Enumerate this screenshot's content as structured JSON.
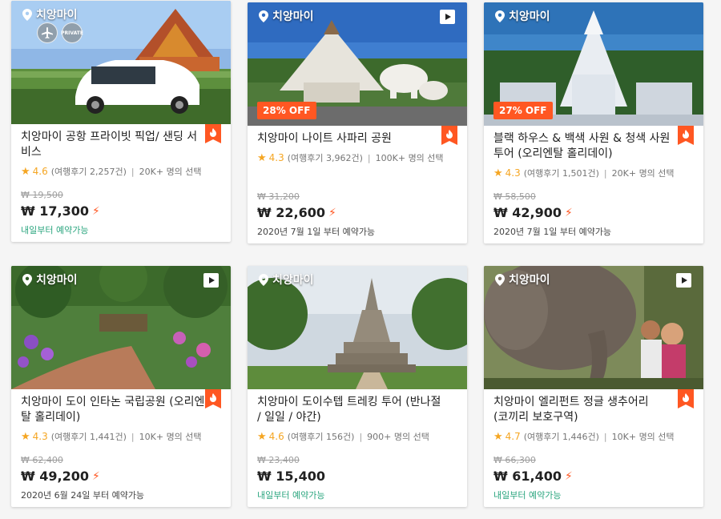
{
  "cards": [
    {
      "location": "치앙마이",
      "title": "치앙마이 공항 프라이빗 픽업/ 샌딩 서비스",
      "rating": "4.6",
      "reviews": "(여행후기 2,257건)",
      "chosen": "20K+ 명의 선택",
      "old_price": "₩ 19,500",
      "price": "₩ 17,300",
      "availability": "내일부터 예약가능",
      "feature_badge": "PRIVATE"
    },
    {
      "location": "치앙마이",
      "title": "치앙마이 나이트 사파리 공원",
      "rating": "4.3",
      "reviews": "(여행후기 3,962건)",
      "chosen": "100K+ 명의 선택",
      "old_price": "₩ 31,200",
      "price": "₩ 22,600",
      "availability": "2020년 7월 1일 부터 예약가능",
      "discount": "28% OFF"
    },
    {
      "location": "치앙마이",
      "title": "블랙 하우스 & 백색 사원 & 청색 사원 투어 (오리엔탈 홀리데이)",
      "rating": "4.3",
      "reviews": "(여행후기 1,501건)",
      "chosen": "20K+ 명의 선택",
      "old_price": "₩ 58,500",
      "price": "₩ 42,900",
      "availability": "2020년 7월 1일 부터 예약가능",
      "discount": "27% OFF"
    },
    {
      "location": "치앙마이",
      "title": "치앙마이 도이 인타논 국립공원 (오리엔탈 홀리데이)",
      "rating": "4.3",
      "reviews": "(여행후기 1,441건)",
      "chosen": "10K+ 명의 선택",
      "old_price": "₩ 62,400",
      "price": "₩ 49,200",
      "availability": "2020년 6월 24일 부터 예약가능"
    },
    {
      "location": "치앙마이",
      "title": "치앙마이 도이수텝 트레킹 투어 (반나절 / 일일 / 야간)",
      "rating": "4.6",
      "reviews": "(여행후기 156건)",
      "chosen": "900+ 명의 선택",
      "old_price": "₩ 23,400",
      "price": "₩ 15,400",
      "availability": "내일부터 예약가능"
    },
    {
      "location": "치앙마이",
      "title": "치앙마이 엘리펀트 정글 생추어리 (코끼리 보호구역)",
      "rating": "4.7",
      "reviews": "(여행후기 1,446건)",
      "chosen": "10K+ 명의 선택",
      "old_price": "₩ 66,300",
      "price": "₩ 61,400",
      "availability": "내일부터 예약가능"
    }
  ],
  "colors": {
    "accent": "#ff5722",
    "star": "#f5a623",
    "available_green": "#2aa57e"
  },
  "icons": [
    "location-pin-icon",
    "play-video-icon",
    "airplane-icon",
    "hot-flame-icon",
    "lightning-icon",
    "star-icon"
  ]
}
